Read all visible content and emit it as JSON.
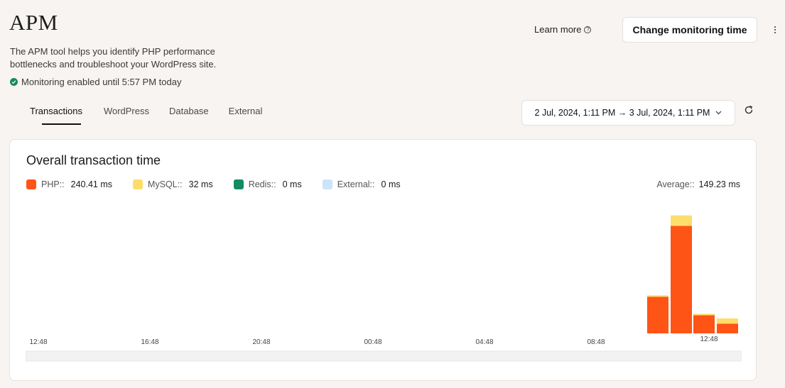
{
  "header": {
    "title": "APM",
    "description": "The APM tool helps you identify PHP performance bottlenecks and troubleshoot your WordPress site.",
    "status": "Monitoring enabled until 5:57 PM today",
    "learn_more": "Learn more",
    "change_button": "Change monitoring time"
  },
  "tabs": [
    {
      "label": "Transactions",
      "active": true
    },
    {
      "label": "WordPress",
      "active": false
    },
    {
      "label": "Database",
      "active": false
    },
    {
      "label": "External",
      "active": false
    }
  ],
  "date_range": "2 Jul, 2024, 1:11 PM → 3 Jul, 2024, 1:11 PM",
  "card": {
    "title": "Overall transaction time",
    "legend": [
      {
        "label": "PHP::",
        "value": "240.41 ms",
        "color": "#fe5415"
      },
      {
        "label": "MySQL::",
        "value": "32 ms",
        "color": "#fddd6b"
      },
      {
        "label": "Redis::",
        "value": "0 ms",
        "color": "#118c63"
      },
      {
        "label": "External::",
        "value": "0 ms",
        "color": "#cbe3fb"
      }
    ],
    "average_label": "Average::",
    "average_value": "149.23 ms"
  },
  "colors": {
    "php": "#fe5415",
    "mysql": "#fddd6b",
    "redis": "#118c63",
    "external": "#cbe3fb",
    "status_ok": "#168a58"
  },
  "chart_data": {
    "type": "bar",
    "stacked": true,
    "x_tick_labels": [
      "12:48",
      "16:48",
      "20:48",
      "00:48",
      "04:48",
      "08:48",
      "12:48"
    ],
    "bars": [
      {
        "php": 105,
        "mysql": 4,
        "redis": 0,
        "external": 0
      },
      {
        "php": 308,
        "mysql": 30,
        "redis": 0,
        "external": 0
      },
      {
        "php": 52,
        "mysql": 4,
        "redis": 0,
        "external": 0
      },
      {
        "php": 28,
        "mysql": 15,
        "redis": 0,
        "external": 0
      }
    ],
    "ylim": [
      0,
      380
    ],
    "grid": false
  }
}
